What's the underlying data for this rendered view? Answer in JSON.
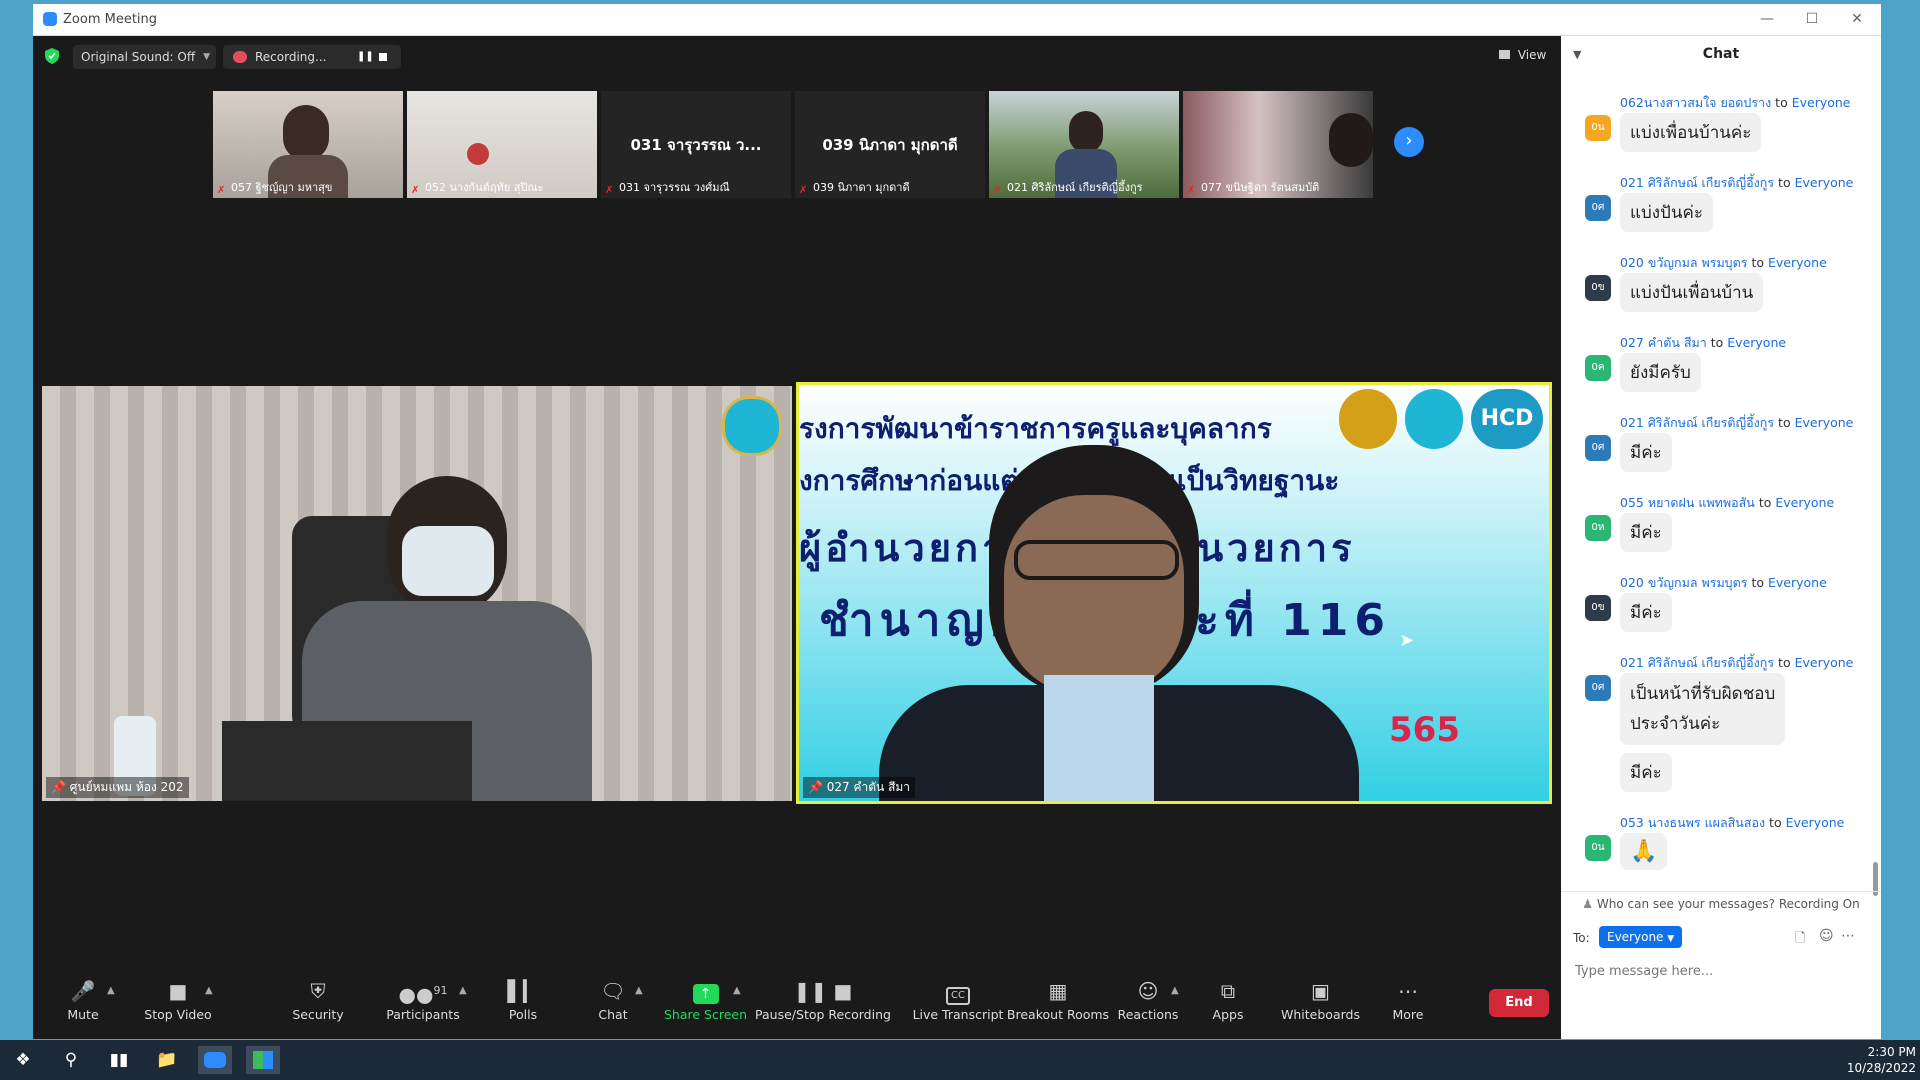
{
  "window": {
    "title": "Zoom Meeting"
  },
  "topbar": {
    "original_sound": "Original Sound: Off",
    "recording": "Recording...",
    "view": "View"
  },
  "thumbnails": [
    {
      "name": "057 ฐิชญ์ญา มหาสุข",
      "big": ""
    },
    {
      "name": "052 นางกันต์ฤทัย  สุปิณะ",
      "big": ""
    },
    {
      "name": "031 จารุวรรณ  วงศ์มณี",
      "big": "031 จารุวรรณ  ว..."
    },
    {
      "name": "039 นิภาดา มุกดาดี",
      "big": "039 นิภาดา มุกดาดี"
    },
    {
      "name": "021 ศิริลักษณ์ เกียรติญี่อึ้งกูร",
      "big": ""
    },
    {
      "name": "077 ขนิษฐิดา  รัตนสมบัติ",
      "big": ""
    }
  ],
  "videos": {
    "left_label": "ศูนย์หมแพม ห้อง 202",
    "right_label": "027 คำตัน สีมา",
    "slide_line1": "รงการพัฒนาข้าราชการครูและบุคลากร",
    "slide_line2": "งการศึกษาก่อนแต่งตั้งและเลื่อนเป็นวิทยฐานะ",
    "slide_line3": "ผู้อำนวยการ รองผู้อำนวยการ",
    "slide_line4": "ชำนาญการ ระยะที่ 116",
    "slide_year": "565",
    "logo_text": "HCD"
  },
  "toolbar": {
    "mute": "Mute",
    "stop_video": "Stop Video",
    "security": "Security",
    "participants": "Participants",
    "participants_count": "91",
    "polls": "Polls",
    "chat": "Chat",
    "share_screen": "Share Screen",
    "pause_stop_recording": "Pause/Stop Recording",
    "live_transcript": "Live Transcript",
    "breakout_rooms": "Breakout Rooms",
    "reactions": "Reactions",
    "apps": "Apps",
    "whiteboards": "Whiteboards",
    "more": "More",
    "end": "End"
  },
  "chat": {
    "title": "Chat",
    "to_word": "to",
    "messages": [
      {
        "sender": "062นางสาวสมใจ ยอดปราง",
        "recipient": "Everyone",
        "text": "แบ่งเพื่อนบ้านค่ะ",
        "avatar": "0น",
        "color": "#f5a623"
      },
      {
        "sender": "021 ศิริลักษณ์ เกียรติญี่อึ้งกูร",
        "recipient": "Everyone",
        "text": "แบ่งปันค่ะ",
        "avatar": "0ศ",
        "color": "#2b7bb9"
      },
      {
        "sender": "020 ขวัญกมล พรมบุตร",
        "recipient": "Everyone",
        "text": "แบ่งปันเพื่อนบ้าน",
        "avatar": "0ข",
        "color": "#2f3a4a"
      },
      {
        "sender": "027 คำตัน สีมา",
        "recipient": "Everyone",
        "text": "ยังมีครับ",
        "avatar": "0ค",
        "color": "#2bb673"
      },
      {
        "sender": "021 ศิริลักษณ์ เกียรติญี่อึ้งกูร",
        "recipient": "Everyone",
        "text": "มีค่ะ",
        "avatar": "0ศ",
        "color": "#2b7bb9"
      },
      {
        "sender": "055 หยาดฝน แพทพอสัน",
        "recipient": "Everyone",
        "text": "มีค่ะ",
        "avatar": "0ห",
        "color": "#2bb673"
      },
      {
        "sender": "020 ขวัญกมล พรมบุตร",
        "recipient": "Everyone",
        "text": "มีค่ะ",
        "avatar": "0ข",
        "color": "#2f3a4a"
      },
      {
        "sender": "021 ศิริลักษณ์ เกียรติญี่อึ้งกูร",
        "recipient": "Everyone",
        "text": "เป็นหน้าที่รับผิดชอบ",
        "text2": "ประจำวันค่ะ",
        "text3": "มีค่ะ",
        "avatar": "0ศ",
        "color": "#2b7bb9"
      },
      {
        "sender": "053 นางธนพร แผลสินสอง",
        "recipient": "Everyone",
        "text": "🙏",
        "avatar": "0น",
        "color": "#2bb673"
      }
    ],
    "privacy_note": "Who can see your messages? Recording On",
    "to_label": "To:",
    "to_value": "Everyone",
    "input_placeholder": "Type message here..."
  },
  "taskbar": {
    "time": "2:30 PM",
    "date": "10/28/2022"
  }
}
